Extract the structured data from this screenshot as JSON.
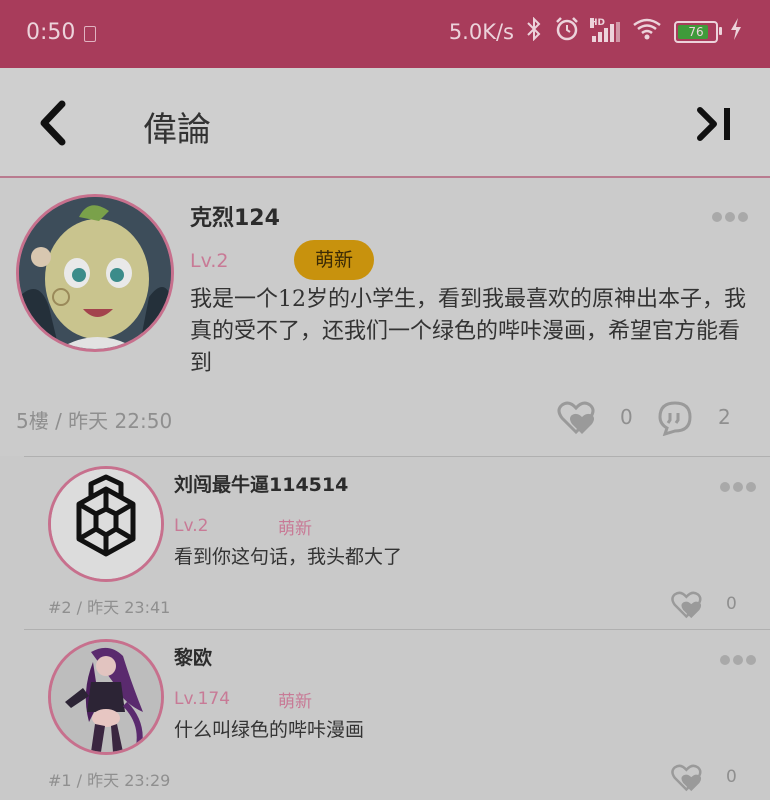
{
  "status_bar": {
    "time": "0:50",
    "network_speed": "5.0K/s",
    "signal_label": "HD",
    "battery_level": "76",
    "icons": [
      "bluetooth-icon",
      "alarm-icon",
      "signal-icon",
      "wifi-icon",
      "battery-icon",
      "charging-icon"
    ]
  },
  "header": {
    "title": "偉論"
  },
  "main_post": {
    "username": "克烈124",
    "level": "Lv.2",
    "badge": "萌新",
    "content": "我是一个12岁的小学生，看到我最喜欢的原神出本子，我真的受不了，还我们一个绿色的哔咔漫画，希望官方能看到",
    "meta": "5樓 / 昨天 22:50",
    "likes": "0",
    "comments": "2"
  },
  "replies": [
    {
      "username": "刘闯最牛逼114514",
      "level": "Lv.2",
      "badge": "萌新",
      "content": "看到你这句话，我头都大了",
      "meta": "#2 / 昨天 23:41",
      "likes": "0"
    },
    {
      "username": "黎欧",
      "level": "Lv.174",
      "badge": "萌新",
      "content": "什么叫绿色的哔咔漫画",
      "meta": "#1 / 昨天 23:29",
      "likes": "0"
    }
  ],
  "colors": {
    "status_bar": "#a83c5b",
    "accent": "#c7708d",
    "badge": "#c8920d",
    "background": "#c9c9c9"
  }
}
